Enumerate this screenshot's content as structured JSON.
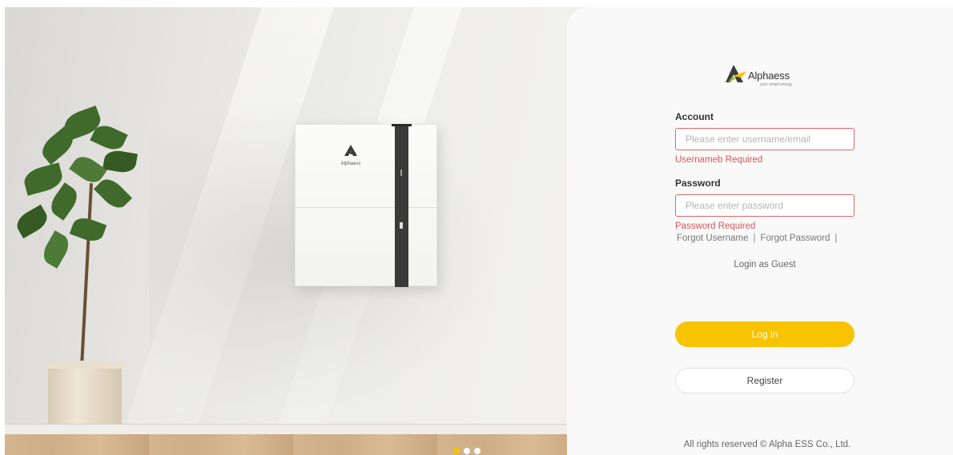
{
  "brand": {
    "name": "Alphaess",
    "tagline": "your smart energy",
    "accent_color": "#f8c300",
    "battery_logo_text": "Alphaess"
  },
  "login": {
    "account_label": "Account",
    "account_placeholder": "Please enter username/email",
    "account_value": "",
    "account_error": "Usernameb Required",
    "password_label": "Password",
    "password_placeholder": "Please enter password",
    "password_value": "",
    "password_error": "Password Required",
    "error_color": "#e05555",
    "forgot_username": "Forgot Username",
    "forgot_password": "Forgot Password",
    "separator": "|",
    "guest_link": "Login as Guest",
    "login_button": "Log in",
    "register_button": "Register"
  },
  "footer": {
    "copyright": "All rights reserved © Alpha ESS Co., Ltd."
  },
  "carousel": {
    "slide_count": 3,
    "active_index": 0
  }
}
